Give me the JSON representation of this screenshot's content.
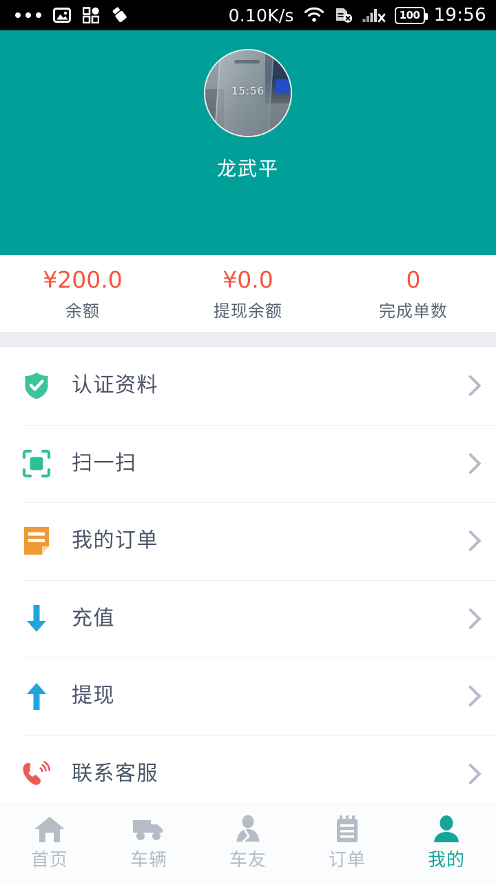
{
  "status_bar": {
    "network_speed": "0.10K/s",
    "battery_level": "100",
    "time": "19:56",
    "left_icons": [
      "more-dots-icon",
      "gallery-icon",
      "apps-grid-icon",
      "cleaner-icon"
    ],
    "right_icons": [
      "wifi-icon",
      "sim-card-disabled-icon",
      "signal-disabled-icon",
      "battery-icon"
    ]
  },
  "profile": {
    "username": "龙武平",
    "avatar_alt": "user-avatar-photo",
    "avatar_photo_clock": "15:56",
    "avatar_photo_caption": "",
    "background_color": "#00a098"
  },
  "stats": [
    {
      "value": "¥200.0",
      "label": "余额",
      "name": "balance"
    },
    {
      "value": "¥0.0",
      "label": "提现余额",
      "name": "withdrawable-balance"
    },
    {
      "value": "0",
      "label": "完成单数",
      "name": "completed-orders"
    }
  ],
  "stat_value_color": "#f4553d",
  "menu": [
    {
      "label": "认证资料",
      "icon": "shield-check-icon",
      "icon_color": "#3ec49b",
      "name": "verification-info"
    },
    {
      "label": "扫一扫",
      "icon": "scan-qr-icon",
      "icon_color": "#2fbf96",
      "name": "scan-qr"
    },
    {
      "label": "我的订单",
      "icon": "document-icon",
      "icon_color": "#f09a33",
      "name": "my-orders"
    },
    {
      "label": "充值",
      "icon": "arrow-down-icon",
      "icon_color": "#22a5dc",
      "name": "recharge"
    },
    {
      "label": "提现",
      "icon": "arrow-up-icon",
      "icon_color": "#22a5dc",
      "name": "withdraw"
    },
    {
      "label": "联系客服",
      "icon": "phone-call-icon",
      "icon_color": "#ee5a52",
      "name": "contact-support"
    }
  ],
  "tabs": [
    {
      "label": "首页",
      "icon": "home-icon",
      "name": "home",
      "active": false
    },
    {
      "label": "车辆",
      "icon": "truck-icon",
      "name": "vehicles",
      "active": false
    },
    {
      "label": "车友",
      "icon": "person-icon",
      "name": "friends",
      "active": false
    },
    {
      "label": "订单",
      "icon": "clipboard-icon",
      "name": "orders",
      "active": false
    },
    {
      "label": "我的",
      "icon": "user-icon",
      "name": "mine",
      "active": true
    }
  ],
  "tab_active_color": "#15a699",
  "tab_inactive_color": "#b6bcc6"
}
